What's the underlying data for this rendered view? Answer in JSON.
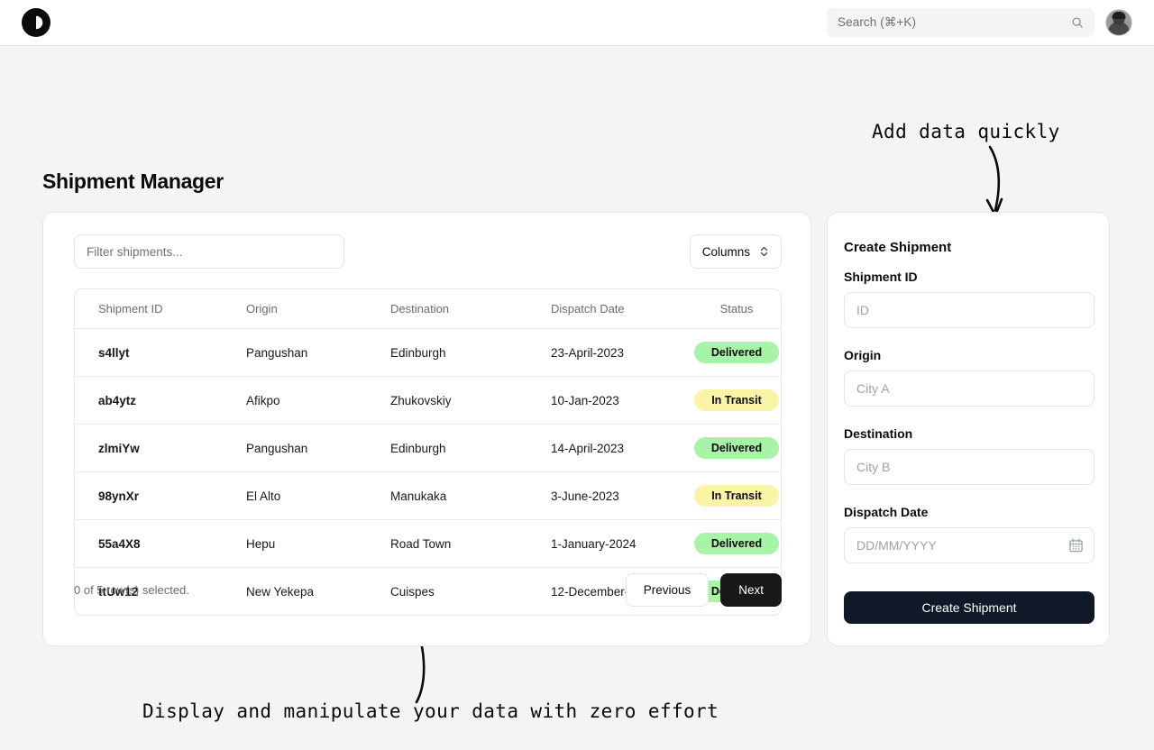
{
  "topbar": {
    "logo_icon": "contrast-circle-icon",
    "search": {
      "placeholder": "Search (⌘+K)",
      "value": "",
      "icon": "search-icon"
    },
    "avatar_alt": "user-avatar"
  },
  "page": {
    "title": "Shipment Manager",
    "background": "#f4f4f5"
  },
  "table_panel": {
    "filter": {
      "placeholder": "Filter shipments...",
      "value": ""
    },
    "columns_button": {
      "label": "Columns",
      "icon": "chevron-up-down-icon"
    },
    "columns": [
      "Shipment ID",
      "Origin",
      "Destination",
      "Dispatch Date",
      "Status"
    ],
    "rows": [
      {
        "shipment_id": "s4llyt",
        "origin": "Pangushan",
        "destination": "Edinburgh",
        "dispatch_date": "23-April-2023",
        "status": "Delivered",
        "status_kind": "delivered"
      },
      {
        "shipment_id": "ab4ytz",
        "origin": "Afikpo",
        "destination": "Zhukovskiy",
        "dispatch_date": "10-Jan-2023",
        "status": "In Transit",
        "status_kind": "transit"
      },
      {
        "shipment_id": "zlmiYw",
        "origin": "Pangushan",
        "destination": "Edinburgh",
        "dispatch_date": "14-April-2023",
        "status": "Delivered",
        "status_kind": "delivered"
      },
      {
        "shipment_id": "98ynXr",
        "origin": "El Alto",
        "destination": "Manukaka",
        "dispatch_date": "3-June-2023",
        "status": "In Transit",
        "status_kind": "transit"
      },
      {
        "shipment_id": "55a4X8",
        "origin": "Hepu",
        "destination": "Road Town",
        "dispatch_date": "1-January-2024",
        "status": "Delivered",
        "status_kind": "delivered"
      },
      {
        "shipment_id": "ttUw12",
        "origin": "New Yekepa",
        "destination": "Cuispes",
        "dispatch_date": "12-December-2023",
        "status": "Delivered",
        "status_kind": "delivered"
      }
    ],
    "footer": {
      "selection_text": "0 of 5 row(s) selected.",
      "previous_label": "Previous",
      "next_label": "Next"
    }
  },
  "form_panel": {
    "title": "Create Shipment",
    "fields": [
      {
        "label": "Shipment ID",
        "placeholder": "ID",
        "value": ""
      },
      {
        "label": "Origin",
        "placeholder": "City A",
        "value": ""
      },
      {
        "label": "Destination",
        "placeholder": "City B",
        "value": ""
      },
      {
        "label": "Dispatch Date",
        "placeholder": "DD/MM/YYYY",
        "value": "",
        "icon": "calendar-icon"
      }
    ],
    "submit_label": "Create Shipment"
  },
  "annotations": {
    "top": "Add data quickly",
    "bottom": "Display and manipulate your data with zero effort"
  },
  "colors": {
    "accent_dark": "#111827",
    "badge_delivered": "#a7f3a7",
    "badge_transit": "#faf5a6",
    "page_bg": "#f4f4f5",
    "card_bg": "#ffffff",
    "border": "#e6e7eb"
  }
}
